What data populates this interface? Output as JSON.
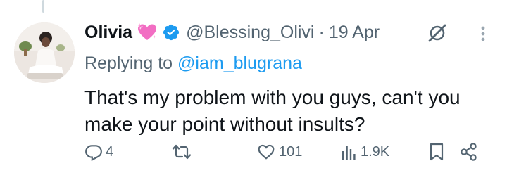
{
  "tweet": {
    "display_name": "Olivia",
    "name_emoji_icon": "sparkling-heart-icon",
    "verified_icon": "verified-badge-icon",
    "handle": "@Blessing_Olivi",
    "separator": "·",
    "date": "19 Apr",
    "reply_prefix": "Replying to",
    "reply_to": "@iam_blugrana",
    "text_line1": "That's my problem with you guys, can't you",
    "text_line2": "make your point without insults?"
  },
  "actions": {
    "replies": "4",
    "retweets": "",
    "likes": "101",
    "views": "1.9K"
  },
  "colors": {
    "primary_text": "#0f1419",
    "secondary_text": "#536471",
    "accent_blue": "#1d9bf0",
    "heart_pink": "#f26ec3",
    "thread_line": "#cfd9de"
  }
}
